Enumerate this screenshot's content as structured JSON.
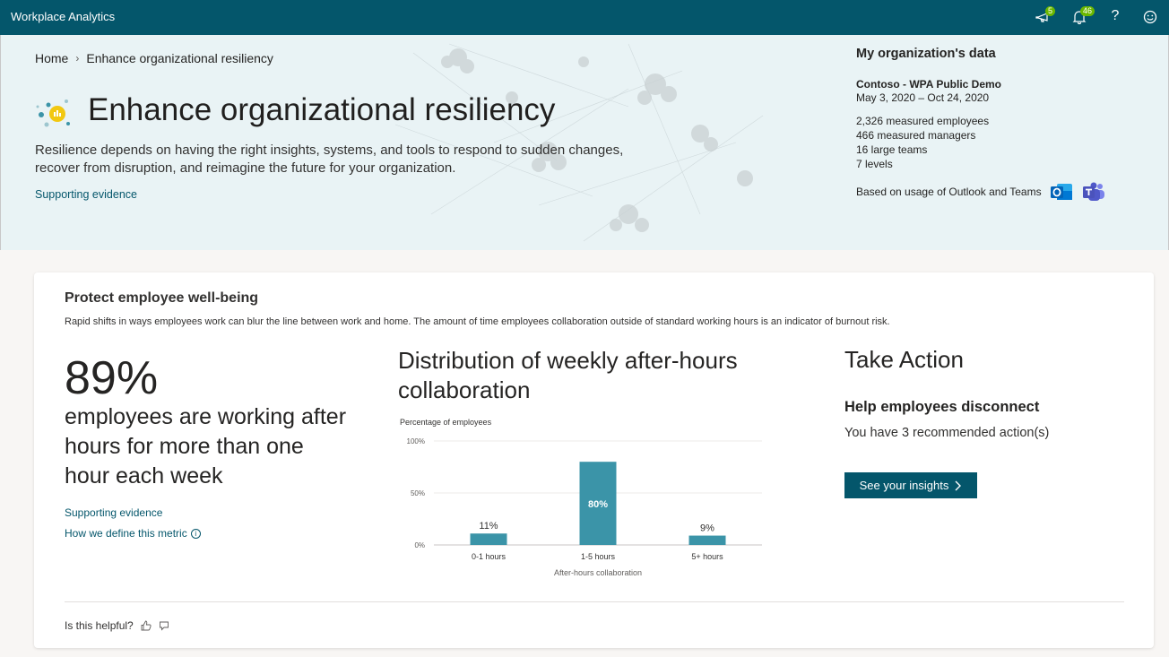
{
  "app": {
    "title": "Workplace Analytics"
  },
  "topbar": {
    "feedback_badge": "5",
    "notifications_badge": "46",
    "help_glyph": "?"
  },
  "breadcrumb": {
    "home": "Home",
    "separator": "›",
    "current": "Enhance organizational resiliency"
  },
  "hero": {
    "title": "Enhance organizational resiliency",
    "description": "Resilience depends on having the right insights, systems, and tools to respond to sudden changes, recover from disruption, and reimagine the future for your organization.",
    "link": "Supporting evidence"
  },
  "org": {
    "heading": "My organization's data",
    "name": "Contoso - WPA Public Demo",
    "dates": "May 3, 2020 – Oct 24, 2020",
    "stats": [
      "2,326 measured employees",
      "466 measured managers",
      "16 large teams",
      "7 levels"
    ],
    "usage": "Based on usage of Outlook and Teams",
    "icons": [
      "outlook-icon",
      "teams-icon"
    ]
  },
  "card": {
    "title": "Protect employee well-being",
    "description": "Rapid shifts in ways employees work can blur the line between work and home. The amount of time employees collaboration outside of standard working hours is an indicator of burnout risk.",
    "big_metric": "89%",
    "big_text": "employees are working after hours for more than one hour each week",
    "link_evidence": "Supporting evidence",
    "link_definition": "How we define this metric",
    "helpful": "Is this helpful?"
  },
  "chart_title": "Distribution of weekly after-hours collaboration",
  "chart_data": {
    "type": "bar",
    "categories": [
      "0-1 hours",
      "1-5 hours",
      "5+ hours"
    ],
    "values": [
      11,
      80,
      9
    ],
    "data_labels": [
      "11%",
      "80%",
      "9%"
    ],
    "ylabel": "Percentage of employees",
    "xlabel": "After-hours collaboration",
    "yticks": [
      "0%",
      "50%",
      "100%"
    ],
    "ylim": [
      0,
      100
    ],
    "grid": true,
    "bar_color": "#3b94a8"
  },
  "take_action": {
    "title": "Take Action",
    "subtitle": "Help employees disconnect",
    "count_text": "You have 3 recommended action(s)",
    "button_label": "See your insights"
  },
  "colors": {
    "brand": "#04566b",
    "badge": "#6bb700",
    "hero_bg": "#e9f3f5"
  }
}
